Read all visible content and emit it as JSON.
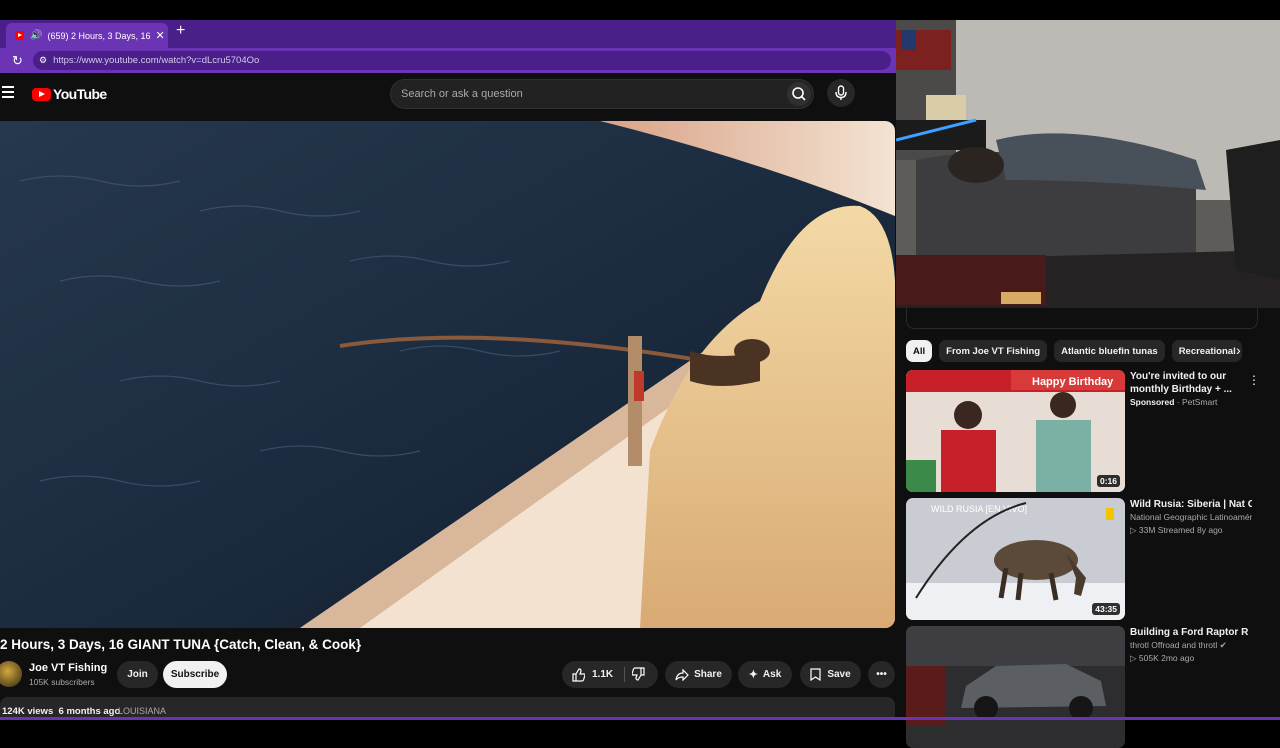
{
  "browser": {
    "tab_title": "(659) 2 Hours, 3 Days, 16 GIAN",
    "tab_close": "✕",
    "new_tab": "+",
    "url": "https://www.youtube.com/watch?v=dLcru5704Oo"
  },
  "youtube": {
    "logo_text": "YouTube",
    "search_placeholder": "Search or ask a question"
  },
  "video": {
    "title": "2 Hours, 3 Days, 16 GIANT TUNA {Catch, Clean, & Cook}",
    "channel": "Joe VT Fishing",
    "subscribers": "105K subscribers",
    "join_label": "Join",
    "subscribe_label": "Subscribe",
    "likes": "1.1K",
    "share_label": "Share",
    "ask_label": "Ask",
    "save_label": "Save",
    "views": "124K views",
    "age": "6 months ago",
    "location_tag": "LOUISIANA"
  },
  "chips": [
    "All",
    "From Joe VT Fishing",
    "Atlantic bluefin tunas",
    "Recreational"
  ],
  "recommendations": [
    {
      "title": "You're invited to our monthly Birthday + ...",
      "sponsored": "Sponsored",
      "advertiser": "PetSmart",
      "duration": "0:16",
      "thumb_text": "Happy Birthday"
    },
    {
      "title": "Wild Rusia: Siberia | Nat Geo",
      "channel": "National Geographic Latinoaméri",
      "meta": "33M Streamed 8y ago",
      "duration": "43:35",
      "thumb_text": "WILD RUSIA [EN VIVO]"
    },
    {
      "title": "Building a Ford Raptor R",
      "channel": "throtl Offroad and throtl",
      "meta": "505K 2mo ago"
    }
  ],
  "colors": {
    "browser_purple": "#6a34b4",
    "browser_dark_purple": "#4a1f8a",
    "yt_red": "#ff0000",
    "yt_bg": "#0f0f0f"
  }
}
